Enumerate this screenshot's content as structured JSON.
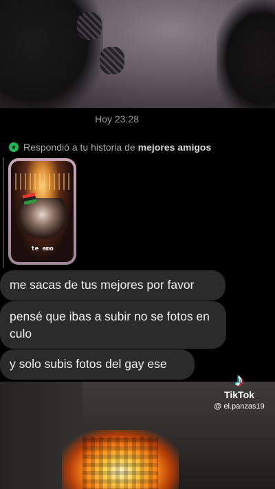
{
  "chat": {
    "timestamp": "Hoy 23:28",
    "reply_note_prefix": "Respondió a tu historia de",
    "reply_note_bold": "mejores amigos",
    "story_caption": "te amo",
    "messages": [
      {
        "text": "me sacas de tus mejores por favor"
      },
      {
        "text": "pensé que ibas a subir no se fotos en culo"
      },
      {
        "text": "y solo subis fotos del gay ese"
      }
    ]
  },
  "watermark": {
    "brand": "TikTok",
    "handle": "@ el.panzas19",
    "icon": "tiktok-note-icon"
  },
  "colors": {
    "bubble": "#2b2b2b",
    "close_friends_badge": "#1db954",
    "background": "#000000"
  }
}
